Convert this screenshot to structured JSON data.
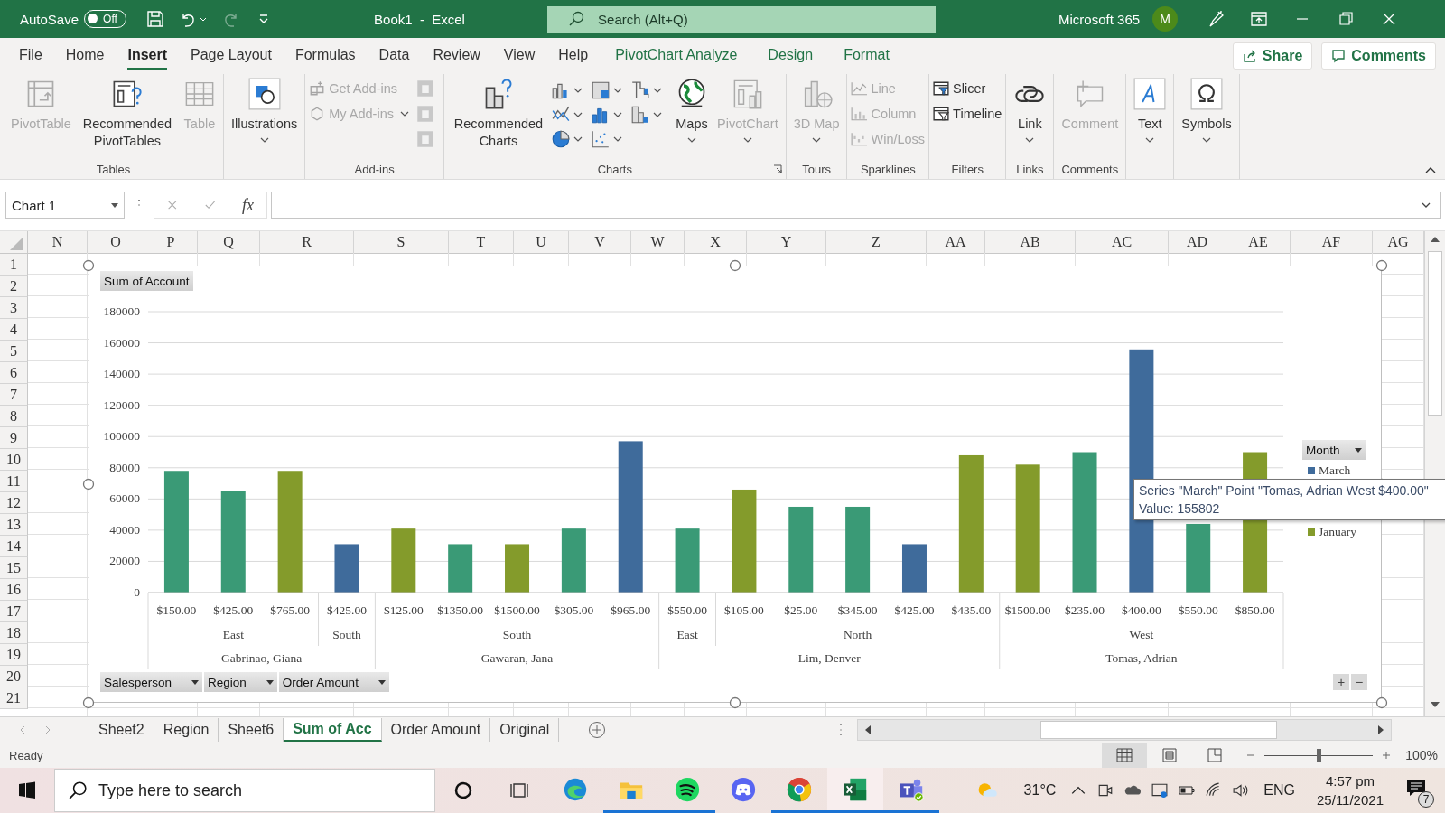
{
  "title_bar": {
    "autosave_label": "AutoSave",
    "autosave": {
      "label": "Off",
      "on": false
    },
    "title": "Book1  -  Excel",
    "search": {
      "placeholder": "Search (Alt+Q)"
    },
    "account": "Microsoft 365",
    "avatar": "M"
  },
  "ribbon_tabs": [
    {
      "label": "File",
      "selected": false,
      "kind": "standard"
    },
    {
      "label": "Home",
      "selected": false,
      "kind": "standard"
    },
    {
      "label": "Insert",
      "selected": true,
      "kind": "standard"
    },
    {
      "label": "Page Layout",
      "selected": false,
      "kind": "standard"
    },
    {
      "label": "Formulas",
      "selected": false,
      "kind": "standard"
    },
    {
      "label": "Data",
      "selected": false,
      "kind": "standard"
    },
    {
      "label": "Review",
      "selected": false,
      "kind": "standard"
    },
    {
      "label": "View",
      "selected": false,
      "kind": "standard"
    },
    {
      "label": "Help",
      "selected": false,
      "kind": "standard"
    },
    {
      "label": "PivotChart Analyze",
      "selected": false,
      "kind": "contextual"
    },
    {
      "label": "Design",
      "selected": false,
      "kind": "contextual"
    },
    {
      "label": "Format",
      "selected": false,
      "kind": "contextual"
    }
  ],
  "share_button": "Share",
  "comments_button": "Comments",
  "ribbon_groups": [
    {
      "label": "Tables",
      "items": [
        {
          "kind": "large",
          "label": "PivotTable",
          "disabled": true,
          "has_menu": false
        },
        {
          "kind": "large",
          "label": "Recommended PivotTables",
          "disabled": false,
          "has_menu": false
        },
        {
          "kind": "large",
          "label": "Table",
          "disabled": true,
          "has_menu": false
        }
      ]
    },
    {
      "items": [
        {
          "kind": "large",
          "label": "Illustrations",
          "disabled": false,
          "has_menu": true
        }
      ]
    },
    {
      "label": "Add-ins",
      "items": [
        {
          "kind": "stack",
          "entries": [
            {
              "label": "Get Add-ins",
              "disabled": true,
              "has_menu": false
            },
            {
              "label": "My Add-ins",
              "disabled": true,
              "has_menu": true
            }
          ]
        },
        {
          "kind": "icon-column"
        }
      ]
    },
    {
      "label": "Charts",
      "launcher": true,
      "items": [
        {
          "kind": "large",
          "label": "Recommended Charts",
          "disabled": false,
          "has_menu": false
        },
        {
          "kind": "chart-gallery"
        },
        {
          "kind": "large",
          "label": "Maps",
          "disabled": false,
          "has_menu": true
        },
        {
          "kind": "large",
          "label": "PivotChart",
          "disabled": true,
          "has_menu": true
        }
      ]
    },
    {
      "label": "Tours",
      "items": [
        {
          "kind": "large",
          "label": "3D Map",
          "disabled": true,
          "has_menu": true
        }
      ]
    },
    {
      "label": "Sparklines",
      "items": [
        {
          "kind": "stack",
          "entries": [
            {
              "label": "Line",
              "disabled": true,
              "has_menu": false
            },
            {
              "label": "Column",
              "disabled": true,
              "has_menu": false
            },
            {
              "label": "Win/Loss",
              "disabled": true,
              "has_menu": false
            }
          ]
        }
      ]
    },
    {
      "label": "Filters",
      "items": [
        {
          "kind": "stack",
          "entries": [
            {
              "label": "Slicer",
              "disabled": false,
              "has_menu": false
            },
            {
              "label": "Timeline",
              "disabled": false,
              "has_menu": false
            }
          ]
        }
      ]
    },
    {
      "label": "Links",
      "items": [
        {
          "kind": "large",
          "label": "Link",
          "disabled": false,
          "has_menu": true
        }
      ]
    },
    {
      "label": "Comments",
      "items": [
        {
          "kind": "large",
          "label": "Comment",
          "disabled": true,
          "has_menu": false
        }
      ]
    },
    {
      "items": [
        {
          "kind": "large",
          "label": "Text",
          "disabled": false,
          "has_menu": true
        }
      ]
    },
    {
      "items": [
        {
          "kind": "large",
          "label": "Symbols",
          "disabled": false,
          "has_menu": true
        }
      ]
    }
  ],
  "formula_bar": {
    "name_box": "Chart 1",
    "fx": "fx"
  },
  "columns": [
    "N",
    "O",
    "P",
    "Q",
    "R",
    "S",
    "T",
    "U",
    "V",
    "W",
    "X",
    "Y",
    "Z",
    "AA",
    "AB",
    "AC",
    "AD",
    "AE",
    "AF",
    "AG"
  ],
  "rows": [
    "1",
    "2",
    "3",
    "4",
    "5",
    "6",
    "7",
    "8",
    "9",
    "10",
    "11",
    "12",
    "13",
    "14",
    "15",
    "16",
    "17",
    "18",
    "19",
    "20",
    "21"
  ],
  "chart": {
    "value_field": "Sum of Account",
    "legend_field": "Month",
    "axis_fields": [
      "Salesperson",
      "Region",
      "Order Amount"
    ],
    "salespeople": [
      {
        "label": "Gabrinao, Giana",
        "regions": [
          "East",
          "South"
        ]
      },
      {
        "label": "Gawaran, Jana",
        "regions": [
          "South"
        ]
      },
      {
        "label": "Lim, Denver",
        "regions": [
          "East",
          "North"
        ]
      },
      {
        "label": "Tomas, Adrian",
        "regions": [
          "West"
        ]
      }
    ],
    "tooltip": [
      "Series \"March\" Point \"Tomas, Adrian West $400.00\"",
      "Value: 155802"
    ],
    "zoom_buttons": [
      "+",
      "−"
    ],
    "chart_data": {
      "type": "bar",
      "stacked": true,
      "grid": true,
      "ylim": [
        0,
        180000
      ],
      "yticks": [
        0,
        20000,
        40000,
        60000,
        80000,
        100000,
        120000,
        140000,
        160000,
        180000
      ],
      "categories": [
        "$150.00",
        "$425.00",
        "$765.00",
        "$425.00",
        "$125.00",
        "$1350.00",
        "$1500.00",
        "$305.00",
        "$965.00",
        "$550.00",
        "$105.00",
        "$25.00",
        "$345.00",
        "$425.00",
        "$435.00",
        "$1500.00",
        "$235.00",
        "$400.00",
        "$550.00",
        "$850.00"
      ],
      "series": [
        {
          "name": "March",
          "color": "#3f6b9b",
          "values": [
            null,
            null,
            null,
            31000,
            null,
            null,
            null,
            null,
            97000,
            null,
            null,
            null,
            null,
            31000,
            null,
            null,
            null,
            155802,
            null,
            null
          ]
        },
        {
          "color": "#3a9a76",
          "values": [
            78000,
            65000,
            null,
            null,
            null,
            31000,
            null,
            41000,
            null,
            41000,
            null,
            55000,
            55000,
            null,
            null,
            null,
            90000,
            null,
            44000,
            null
          ]
        },
        {
          "name": "January",
          "color": "#849b2b",
          "values": [
            null,
            null,
            78000,
            null,
            41000,
            null,
            31000,
            null,
            null,
            null,
            66000,
            null,
            null,
            null,
            88000,
            82000,
            null,
            null,
            null,
            90000
          ]
        }
      ]
    }
  },
  "sheet_tabs": [
    {
      "label": "Sheet2",
      "selected": false
    },
    {
      "label": "Region",
      "selected": false
    },
    {
      "label": "Sheet6",
      "selected": false
    },
    {
      "label": "Sum of Acc",
      "selected": true
    },
    {
      "label": "Order Amount",
      "selected": false
    },
    {
      "label": "Original",
      "selected": false
    }
  ],
  "status_bar": {
    "text": "Ready",
    "views": [
      {
        "selected": true
      },
      {
        "selected": false
      },
      {
        "selected": false
      }
    ],
    "zoom_slider": {
      "level": 0.5
    },
    "zoom": "100%"
  },
  "taskbar": {
    "search": {
      "placeholder": "Type here to search"
    },
    "apps": [
      {
        "running": false,
        "selected": false
      },
      {
        "running": true,
        "selected": false
      },
      {
        "running": true,
        "selected": false
      },
      {
        "running": false,
        "selected": false
      },
      {
        "running": true,
        "selected": false
      },
      {
        "running": true,
        "selected": true
      },
      {
        "running": true,
        "selected": false
      }
    ],
    "weather": "31°C",
    "language": "ENG",
    "time": "4:57 pm",
    "date": "25/11/2021",
    "notifications": "7"
  }
}
